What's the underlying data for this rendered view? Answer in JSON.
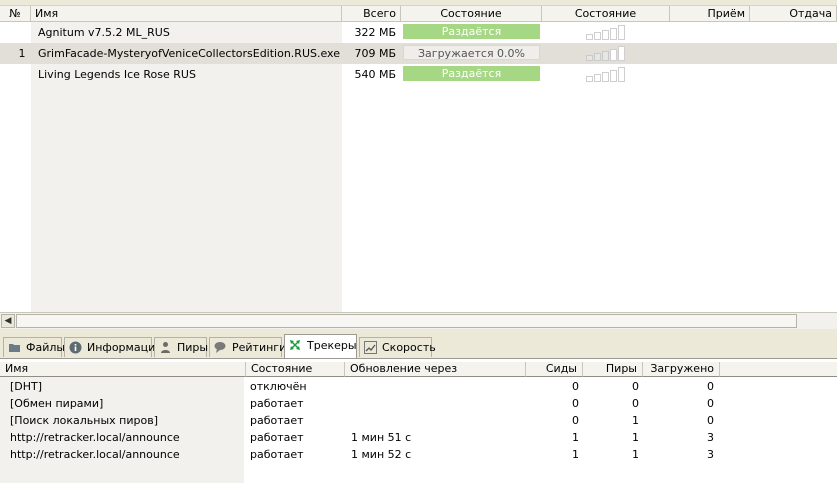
{
  "torrents": {
    "columns": [
      "№",
      "Имя",
      "Всего",
      "Состояние",
      "Состояние",
      "Приём",
      "Отдача"
    ],
    "rows": [
      {
        "num": "",
        "name": "Agnitum v7.5.2 ML_RUS",
        "size": "322 МБ",
        "status": "Раздаётся",
        "status_kind": "seeding",
        "availability": 0.0
      },
      {
        "num": "1",
        "name": "GrimFacade-MysteryofVeniceCollectorsEdition.RUS.exe",
        "size": "709 МБ",
        "status": "Загружается 0.0%",
        "status_kind": "downloading",
        "availability": 0.6
      },
      {
        "num": "",
        "name": "Living Legends Ice Rose RUS",
        "size": "540 МБ",
        "status": "Раздаётся",
        "status_kind": "seeding",
        "availability": 0.0
      }
    ]
  },
  "scrollbar": {
    "left_arrow": "◀"
  },
  "tabs": [
    {
      "label": "Файлы",
      "icon": "folder-icon",
      "active": false
    },
    {
      "label": "Информация",
      "icon": "info-icon",
      "active": false
    },
    {
      "label": "Пиры",
      "icon": "peers-icon",
      "active": false
    },
    {
      "label": "Рейтинги",
      "icon": "ratings-icon",
      "active": false
    },
    {
      "label": "Трекеры",
      "icon": "trackers-icon",
      "active": true
    },
    {
      "label": "Скорость",
      "icon": "speed-icon",
      "active": false
    }
  ],
  "trackers": {
    "columns": [
      "Имя",
      "Состояние",
      "Обновление через",
      "Сиды",
      "Пиры",
      "Загружено"
    ],
    "rows": [
      {
        "name": "[DHT]",
        "state": "отключён",
        "update": "",
        "seeds": "0",
        "peers": "0",
        "downloaded": "0"
      },
      {
        "name": "[Обмен пирами]",
        "state": "работает",
        "update": "",
        "seeds": "0",
        "peers": "0",
        "downloaded": "0"
      },
      {
        "name": "[Поиск локальных пиров]",
        "state": "работает",
        "update": "",
        "seeds": "0",
        "peers": "1",
        "downloaded": "0"
      },
      {
        "name": "http://retracker.local/announce",
        "state": "работает",
        "update": "1 мин 51 с",
        "seeds": "1",
        "peers": "1",
        "downloaded": "3"
      },
      {
        "name": "http://retracker.local/announce",
        "state": "работает",
        "update": "1 мин 52 с",
        "seeds": "1",
        "peers": "1",
        "downloaded": "3"
      }
    ]
  },
  "colors": {
    "seeding": "#a6d785",
    "selected_row": "#e2dfd8",
    "trackers_icon": "#1f9a3a"
  }
}
